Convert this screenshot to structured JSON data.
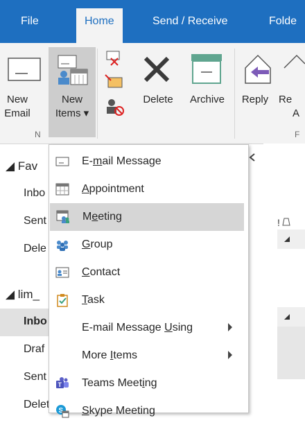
{
  "tabs": [
    {
      "label": "File"
    },
    {
      "label": "Home"
    },
    {
      "label": "Send / Receive"
    },
    {
      "label": "Folde"
    }
  ],
  "ribbon": {
    "new_email": {
      "line1": "New",
      "line2": "Email"
    },
    "new_items": {
      "line1": "New",
      "line2": "Items ▾"
    },
    "delete_label": "Delete",
    "archive_label": "Archive",
    "reply_label": "Reply",
    "reply_all_partial": {
      "line1": "Re",
      "line2": "A"
    },
    "group_new_partial": "N",
    "group_f_partial": "F"
  },
  "nav": {
    "favorites_label": "◢ Fav",
    "inbox_label": "Inbo",
    "sent_label": "Sent",
    "deleted_label": "Dele",
    "account_label": "◢ lim_",
    "inbox2_label": "Inbo",
    "drafts_label": "Draf",
    "sent2_label": "Sent",
    "deleted_items_label": "Deleted Items"
  },
  "menu": {
    "items": [
      {
        "pre": "E-",
        "u": "m",
        "post": "ail Message",
        "icon": "email-message-icon"
      },
      {
        "pre": "",
        "u": "A",
        "post": "ppointment",
        "icon": "appointment-icon"
      },
      {
        "pre": "M",
        "u": "e",
        "post": "eting",
        "icon": "meeting-icon"
      },
      {
        "pre": "",
        "u": "G",
        "post": "roup",
        "icon": "group-icon"
      },
      {
        "pre": "",
        "u": "C",
        "post": "ontact",
        "icon": "contact-icon"
      },
      {
        "pre": "",
        "u": "T",
        "post": "ask",
        "icon": "task-icon"
      },
      {
        "pre": "E-mail Message ",
        "u": "U",
        "post": "sing",
        "icon": "none"
      },
      {
        "pre": "More ",
        "u": "I",
        "post": "tems",
        "icon": "none"
      },
      {
        "pre": "Teams Meet",
        "u": "i",
        "post": "ng",
        "icon": "teams-icon"
      },
      {
        "pre": "",
        "u": "S",
        "post": "kype Meeting",
        "icon": "skype-meeting-icon"
      }
    ]
  },
  "colors": {
    "accent": "#1e6fc0",
    "highlight": "#d6d6d6"
  }
}
